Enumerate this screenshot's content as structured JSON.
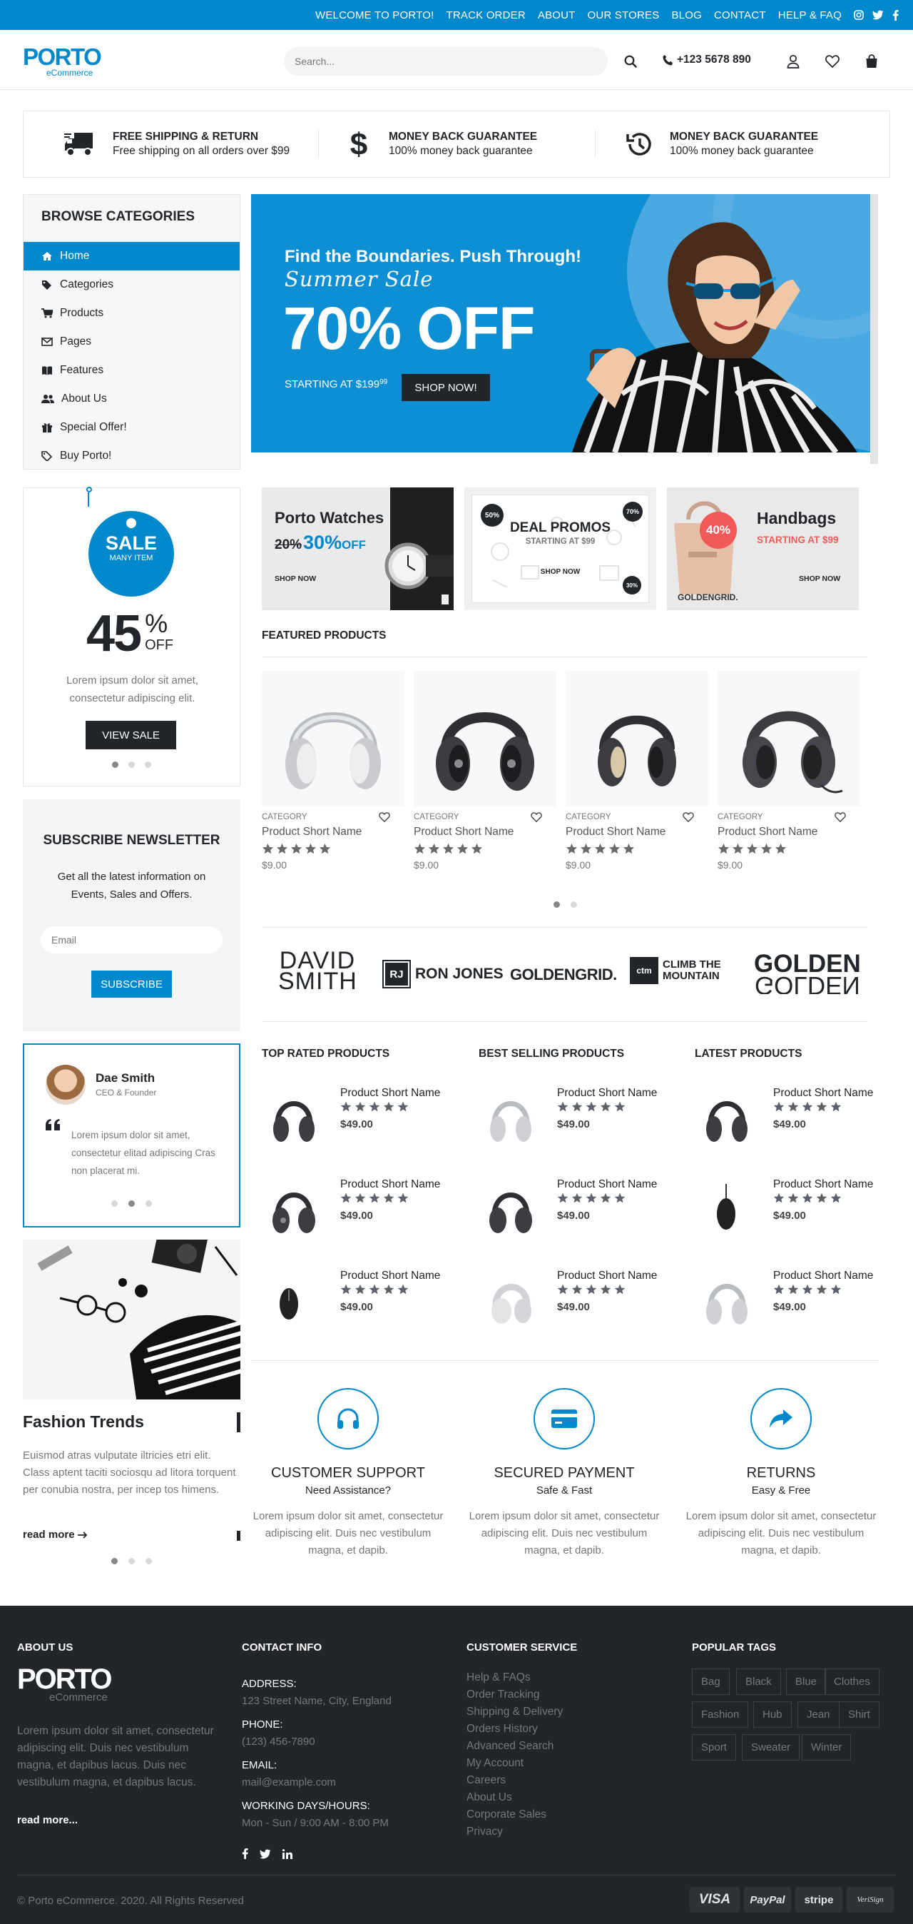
{
  "topbar": {
    "links": [
      "WELCOME TO PORTO!",
      "TRACK ORDER",
      "ABOUT",
      "OUR STORES",
      "BLOG",
      "CONTACT",
      "HELP & FAQ"
    ],
    "social_icons": [
      "instagram-icon",
      "twitter-icon",
      "facebook-icon"
    ]
  },
  "header": {
    "logo": "PORTO",
    "logo_sub": "eCommerce",
    "search_placeholder": "Search...",
    "phone": "+123 5678 890",
    "icons": [
      "search-icon",
      "phone-icon",
      "user-icon",
      "heart-icon",
      "bag-icon"
    ]
  },
  "info_boxes": [
    {
      "title": "FREE SHIPPING & RETURN",
      "subtitle": "Free shipping on all orders over $99",
      "icon": "truck-icon"
    },
    {
      "title": "MONEY BACK GUARANTEE",
      "subtitle": "100% money back guarantee",
      "icon": "dollar-icon"
    },
    {
      "title": "MONEY BACK GUARANTEE",
      "subtitle": "100% money back guarantee",
      "icon": "history-icon"
    }
  ],
  "sidebar": {
    "title": "BROWSE CATEGORIES",
    "items": [
      {
        "label": "Home",
        "icon": "home-icon"
      },
      {
        "label": "Categories",
        "icon": "tags-icon"
      },
      {
        "label": "Products",
        "icon": "cart-icon"
      },
      {
        "label": "Pages",
        "icon": "envelope-icon"
      },
      {
        "label": "Features",
        "icon": "book-icon"
      },
      {
        "label": "About Us",
        "icon": "users-icon"
      },
      {
        "label": "Special Offer!",
        "icon": "gift-icon"
      },
      {
        "label": "Buy Porto!",
        "icon": "tag-icon"
      }
    ]
  },
  "sale_widget": {
    "badge_title": "SALE",
    "badge_sub": "MANY ITEM",
    "percent": "45",
    "percent_sign": "%",
    "off": "OFF",
    "text": "Lorem ipsum dolor sit amet, consectetur adipiscing elit.",
    "button": "VIEW SALE"
  },
  "newsletter": {
    "title": "SUBSCRIBE NEWSLETTER",
    "text": "Get all the latest information on Events, Sales and Offers.",
    "placeholder": "Email",
    "button": "SUBSCRIBE"
  },
  "testimonial": {
    "name": "Dae Smith",
    "role": "CEO & Founder",
    "quote": "Lorem ipsum dolor sit amet, consectetur elitad adipiscing Cras non placerat mi."
  },
  "blog": {
    "title": "Fashion Trends",
    "text": "Euismod atras vulputate iltricies etri elit. Class aptent taciti sociosqu ad litora torquent per conubia nostra, per incep tos himens.",
    "read_more": "read more"
  },
  "banner": {
    "headline": "Find the Boundaries. Push Through!",
    "script": "Summer Sale",
    "big": "70% OFF",
    "starting": "STARTING AT $199",
    "cents": "99",
    "button": "SHOP NOW!"
  },
  "promos": [
    {
      "title": "Porto Watches",
      "old": "20%",
      "pct": "30%",
      "off": "OFF",
      "cta": "SHOP NOW"
    },
    {
      "title": "DEAL PROMOS",
      "sub": "STARTING AT $99",
      "cta": "SHOP NOW",
      "b1": "50%",
      "b2": "70%",
      "b3": "30%"
    },
    {
      "title": "Handbags",
      "sub": "STARTING AT $99",
      "cta": "SHOP NOW",
      "badge": "40%",
      "brand": "GOLDENGRID."
    }
  ],
  "featured": {
    "title": "FEATURED PRODUCTS",
    "products": [
      {
        "category": "CATEGORY",
        "name": "Product Short Name",
        "price": "$9.00",
        "rating": 5
      },
      {
        "category": "CATEGORY",
        "name": "Product Short Name",
        "price": "$9.00",
        "rating": 5
      },
      {
        "category": "CATEGORY",
        "name": "Product Short Name",
        "price": "$9.00",
        "rating": 5
      },
      {
        "category": "CATEGORY",
        "name": "Product Short Name",
        "price": "$9.00",
        "rating": 5
      }
    ]
  },
  "brands": [
    "DAVID SMITH",
    "RON JONES",
    "GOLDENGRID.",
    "CLIMB THE MOUNTAIN",
    "GOLDEN"
  ],
  "lists": [
    {
      "title": "TOP RATED PRODUCTS",
      "items": [
        {
          "name": "Product Short Name",
          "price": "$49.00"
        },
        {
          "name": "Product Short Name",
          "price": "$49.00"
        },
        {
          "name": "Product Short Name",
          "price": "$49.00"
        }
      ]
    },
    {
      "title": "BEST SELLING PRODUCTS",
      "items": [
        {
          "name": "Product Short Name",
          "price": "$49.00"
        },
        {
          "name": "Product Short Name",
          "price": "$49.00"
        },
        {
          "name": "Product Short Name",
          "price": "$49.00"
        }
      ]
    },
    {
      "title": "LATEST PRODUCTS",
      "items": [
        {
          "name": "Product Short Name",
          "price": "$49.00"
        },
        {
          "name": "Product Short Name",
          "price": "$49.00"
        },
        {
          "name": "Product Short Name",
          "price": "$49.00"
        }
      ]
    }
  ],
  "features": [
    {
      "title": "CUSTOMER SUPPORT",
      "sub": "Need Assistance?",
      "text": "Lorem ipsum dolor sit amet, consectetur adipiscing elit. Duis nec vestibulum magna, et dapib.",
      "icon": "headset-icon"
    },
    {
      "title": "SECURED PAYMENT",
      "sub": "Safe & Fast",
      "text": "Lorem ipsum dolor sit amet, consectetur adipiscing elit. Duis nec vestibulum magna, et dapib.",
      "icon": "credit-card-icon"
    },
    {
      "title": "RETURNS",
      "sub": "Easy & Free",
      "text": "Lorem ipsum dolor sit amet, consectetur adipiscing elit. Duis nec vestibulum magna, et dapib.",
      "icon": "share-icon"
    }
  ],
  "footer": {
    "about_title": "ABOUT US",
    "logo": "PORTO",
    "logo_sub": "eCommerce",
    "about_text": "Lorem ipsum dolor sit amet, consectetur adipiscing elit. Duis nec vestibulum magna, et dapibus lacus. Duis nec vestibulum magna, et dapibus lacus.",
    "read_more": "read more...",
    "contact_title": "CONTACT INFO",
    "contact": [
      {
        "label": "ADDRESS:",
        "value": "123 Street Name, City, England"
      },
      {
        "label": "PHONE:",
        "value": "(123) 456-7890"
      },
      {
        "label": "EMAIL:",
        "value": "mail@example.com"
      },
      {
        "label": "WORKING DAYS/HOURS:",
        "value": "Mon - Sun / 9:00 AM - 8:00 PM"
      }
    ],
    "service_title": "CUSTOMER SERVICE",
    "service_links": [
      "Help & FAQs",
      "Order Tracking",
      "Shipping & Delivery",
      "Orders History",
      "Advanced Search",
      "My Account",
      "Careers",
      "About Us",
      "Corporate Sales",
      "Privacy"
    ],
    "tags_title": "POPULAR TAGS",
    "tags": [
      "Bag",
      "Black",
      "Blue",
      "Clothes",
      "Fashion",
      "Hub",
      "Jean",
      "Shirt",
      "Sport",
      "Sweater",
      "Winter"
    ],
    "copyright": "© Porto eCommerce. 2020. All Rights Reserved",
    "payments": [
      "VISA",
      "PayPal",
      "stripe",
      "VeriSign"
    ]
  },
  "colors": {
    "accent": "#0088cc",
    "dark": "#222529",
    "footer": "#222529"
  }
}
